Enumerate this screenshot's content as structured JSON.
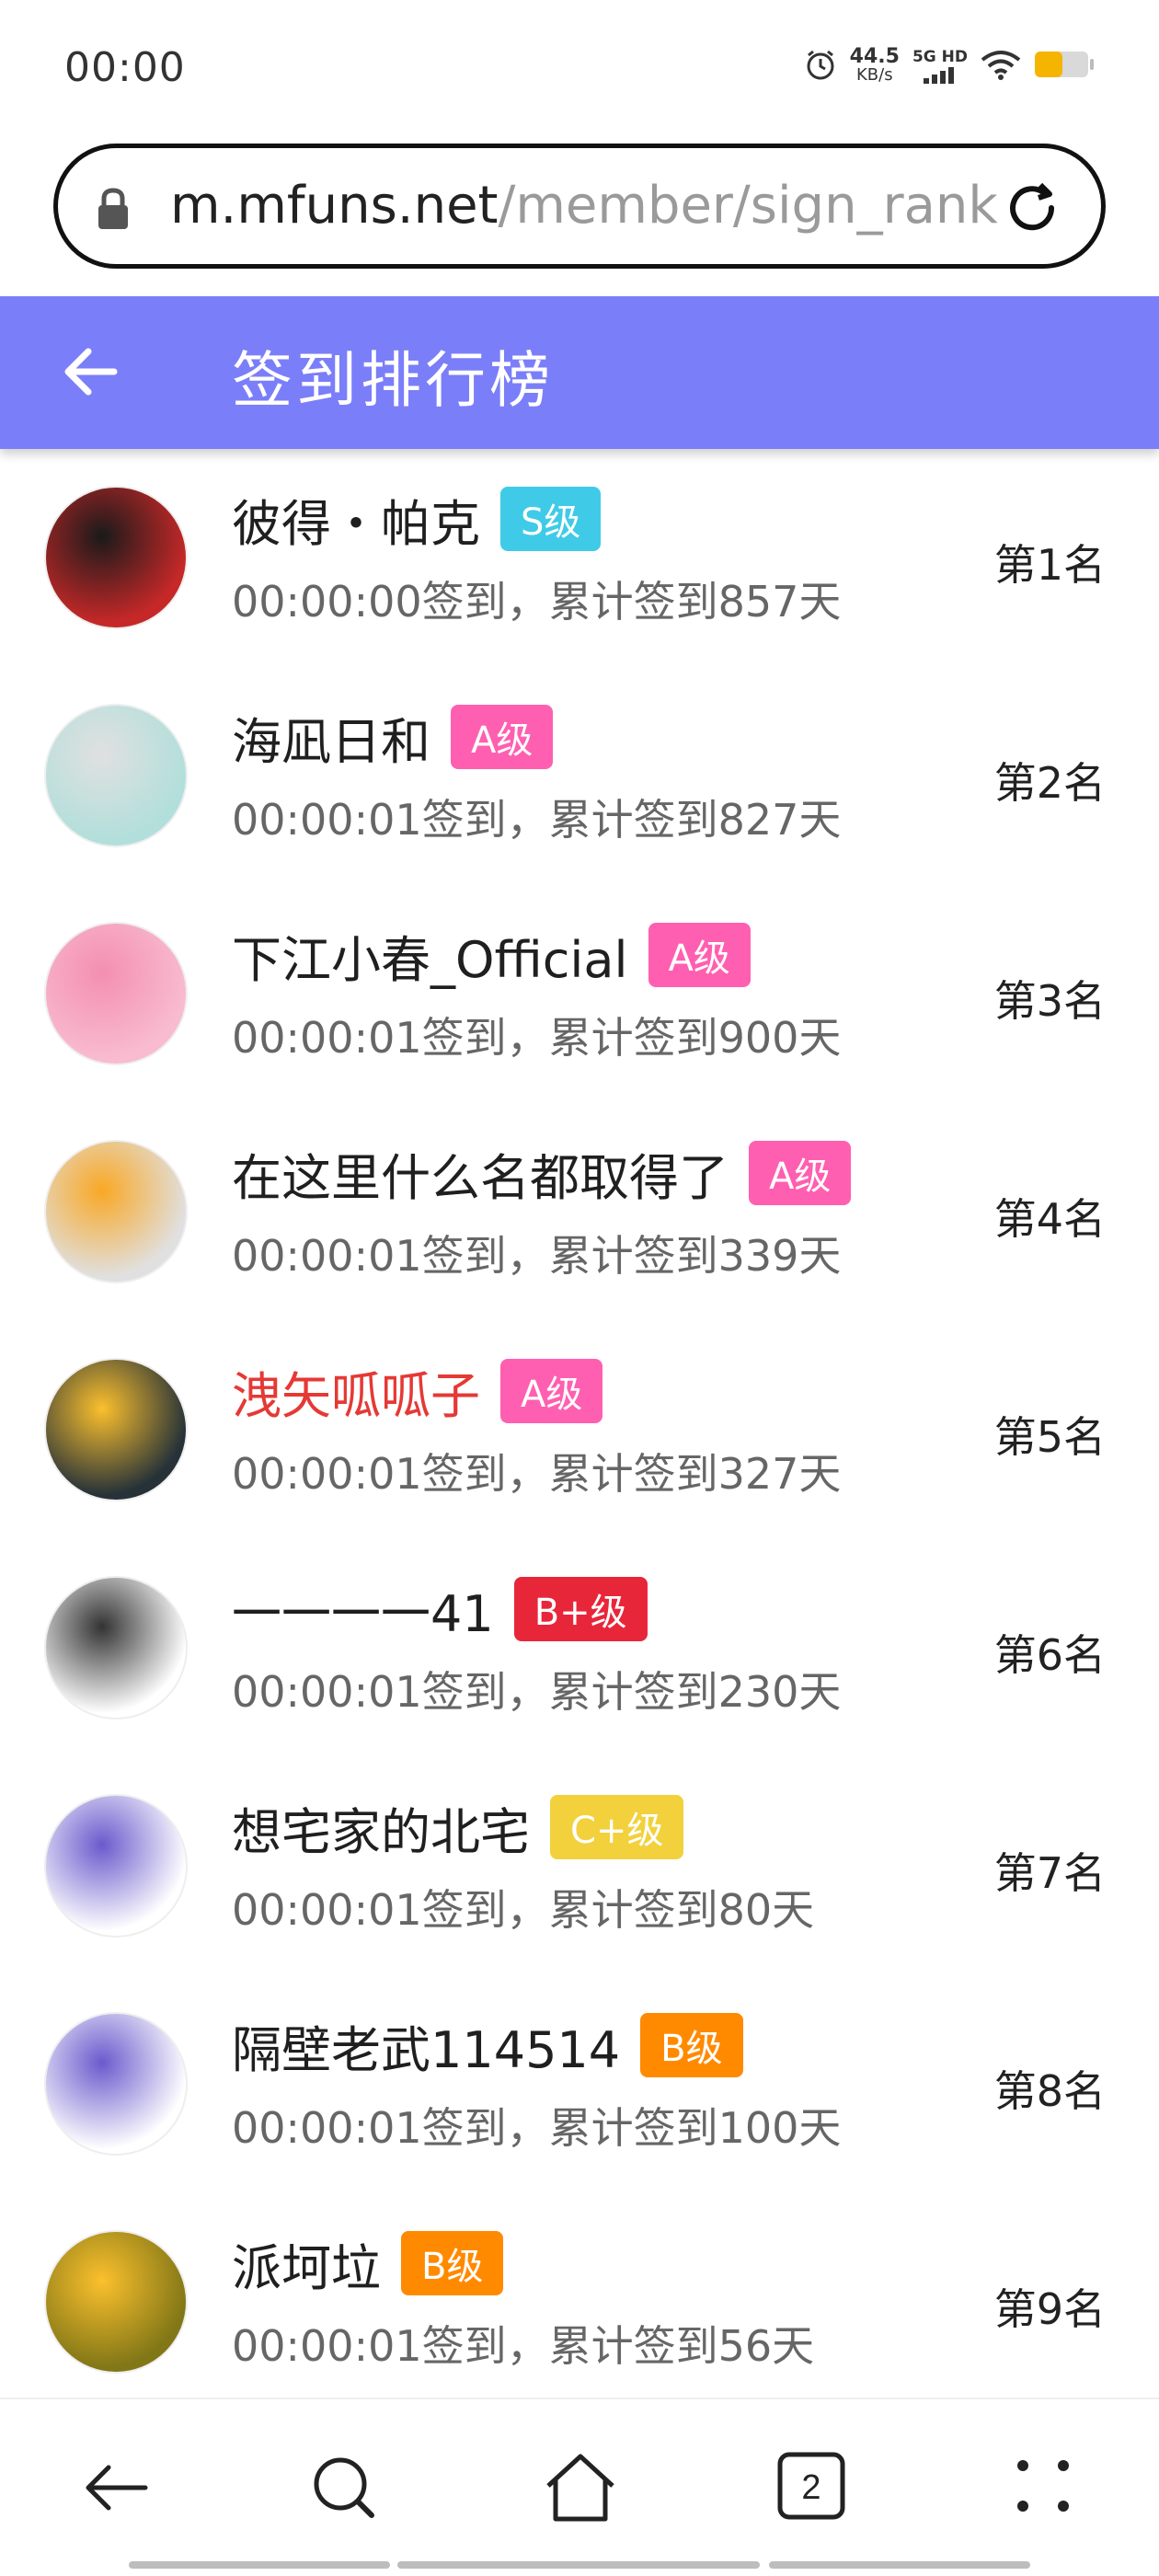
{
  "status_bar": {
    "time": "00:00",
    "net_speed_value": "44.5",
    "net_speed_unit": "KB/s",
    "network_tag": "5G HD",
    "icons": [
      "alarm-icon",
      "signal-icon",
      "wifi-icon",
      "battery-icon"
    ]
  },
  "browser": {
    "url_domain": "m.mfuns.net",
    "url_path": "/member/sign_rank"
  },
  "header": {
    "title": "签到排行榜",
    "accent_color": "#7b7ef9"
  },
  "rank_list": [
    {
      "name": "彼得・帕克",
      "level": "S级",
      "level_color": "#3fcbe8",
      "info": "00:00:00签到，累计签到857天",
      "rank": "第1名",
      "name_color": "default"
    },
    {
      "name": "海凪日和",
      "level": "A级",
      "level_color": "#ff5fb0",
      "info": "00:00:01签到，累计签到827天",
      "rank": "第2名",
      "name_color": "default"
    },
    {
      "name": "下江小春_Official",
      "level": "A级",
      "level_color": "#ff5fb0",
      "info": "00:00:01签到，累计签到900天",
      "rank": "第3名",
      "name_color": "default"
    },
    {
      "name": "在这里什么名都取得了",
      "level": "A级",
      "level_color": "#ff5fb0",
      "info": "00:00:01签到，累计签到339天",
      "rank": "第4名",
      "name_color": "default"
    },
    {
      "name": "洩矢呱呱子",
      "level": "A级",
      "level_color": "#ff5fb0",
      "info": "00:00:01签到，累计签到327天",
      "rank": "第5名",
      "name_color": "red"
    },
    {
      "name": "一一一一41",
      "level": "B+级",
      "level_color": "#e8263a",
      "info": "00:00:01签到，累计签到230天",
      "rank": "第6名",
      "name_color": "default"
    },
    {
      "name": "想宅家的北宅",
      "level": "C+级",
      "level_color": "#f2d13c",
      "info": "00:00:01签到，累计签到80天",
      "rank": "第7名",
      "name_color": "default"
    },
    {
      "name": "隔壁老武114514",
      "level": "B级",
      "level_color": "#ff8a00",
      "info": "00:00:01签到，累计签到100天",
      "rank": "第8名",
      "name_color": "default"
    },
    {
      "name": "派坷垃",
      "level": "B级",
      "level_color": "#ff8a00",
      "info": "00:00:01签到，累计签到56天",
      "rank": "第9名",
      "name_color": "default"
    }
  ],
  "bottom_nav": {
    "tab_count": "2",
    "icons": [
      "back-icon",
      "search-icon",
      "home-icon",
      "tabs-icon",
      "menu-icon"
    ]
  }
}
